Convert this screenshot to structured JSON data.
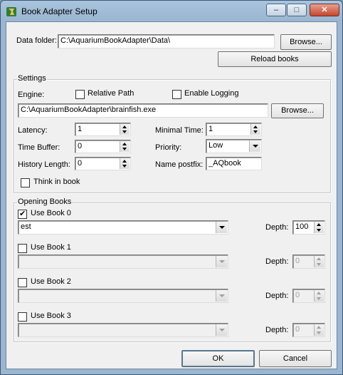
{
  "window": {
    "title": "Book Adapter Setup",
    "icon": "aquarium-app-icon",
    "minimize_glyph": "–",
    "maximize_glyph": "□",
    "close_glyph": "✕"
  },
  "data_folder": {
    "label": "Data folder:",
    "value": "C:\\AquariumBookAdapter\\Data\\",
    "browse_label": "Browse...",
    "reload_label": "Reload books"
  },
  "settings": {
    "group_label": "Settings",
    "engine_label": "Engine:",
    "relative_path_label": "Relative Path",
    "relative_path_checked": false,
    "enable_logging_label": "Enable Logging",
    "enable_logging_checked": false,
    "engine_path": "C:\\AquariumBookAdapter\\brainfish.exe",
    "browse_label": "Browse...",
    "latency_label": "Latency:",
    "latency_value": "1",
    "time_buffer_label": "Time Buffer:",
    "time_buffer_value": "0",
    "history_length_label": "History Length:",
    "history_length_value": "0",
    "minimal_time_label": "Minimal Time:",
    "minimal_time_value": "1",
    "priority_label": "Priority:",
    "priority_value": "Low",
    "name_postfix_label": "Name postfix:",
    "name_postfix_value": "_AQbook",
    "think_in_book_label": "Think in book",
    "think_in_book_checked": false
  },
  "opening_books": {
    "group_label": "Opening Books",
    "depth_label": "Depth:",
    "books": [
      {
        "label": "Use Book 0",
        "checked": true,
        "selected": "est",
        "depth": "100"
      },
      {
        "label": "Use Book 1",
        "checked": false,
        "selected": "",
        "depth": "0"
      },
      {
        "label": "Use Book 2",
        "checked": false,
        "selected": "",
        "depth": "0"
      },
      {
        "label": "Use Book 3",
        "checked": false,
        "selected": "",
        "depth": "0"
      }
    ]
  },
  "buttons": {
    "ok_label": "OK",
    "cancel_label": "Cancel"
  }
}
